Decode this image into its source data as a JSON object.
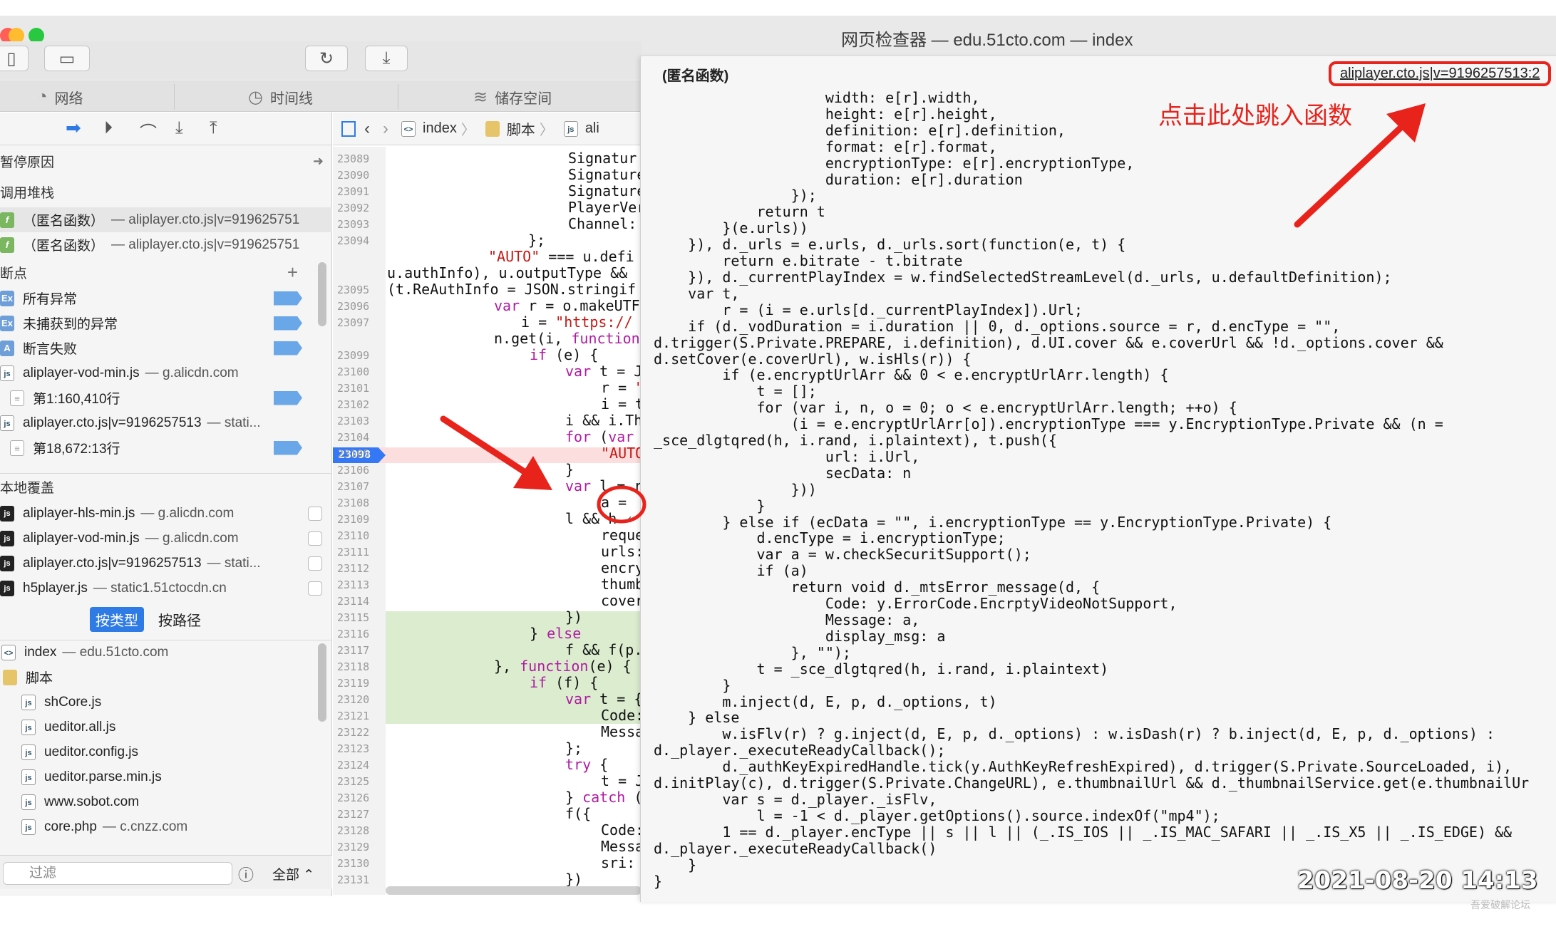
{
  "window": {
    "title": "网页检查器 — edu.51cto.com — index"
  },
  "tabs": [
    {
      "label": "网络",
      "icon": "network-icon"
    },
    {
      "label": "时间线",
      "icon": "clock-icon"
    },
    {
      "label": "储存空间",
      "icon": "storage-icon"
    }
  ],
  "sidebar": {
    "pause_reason": "暂停原因",
    "call_stack": "调用堆栈",
    "stack": [
      {
        "name": "（匿名函数）",
        "location": "— aliplayer.cto.js|v=919625751"
      },
      {
        "name": "（匿名函数）",
        "location": "— aliplayer.cto.js|v=919625751"
      }
    ],
    "breakpoints": "断点",
    "breakpoint_items": [
      {
        "label": "所有异常",
        "icon": "Ex"
      },
      {
        "label": "未捕获到的异常",
        "icon": "Ex"
      },
      {
        "label": "断言失败",
        "icon": "A"
      },
      {
        "label": "aliplayer-vod-min.js",
        "host": "— g.alicdn.com"
      },
      {
        "label": "第1:160,410行"
      },
      {
        "label": "aliplayer.cto.js|v=9196257513",
        "host": "— stati..."
      },
      {
        "label": "第18,672:13行"
      }
    ],
    "local_overrides": "本地覆盖",
    "overrides": [
      {
        "label": "aliplayer-hls-min.js",
        "host": "— g.alicdn.com"
      },
      {
        "label": "aliplayer-vod-min.js",
        "host": "— g.alicdn.com"
      },
      {
        "label": "aliplayer.cto.js|v=9196257513",
        "host": "— stati..."
      },
      {
        "label": "h5player.js",
        "host": "— static1.51ctocdn.cn"
      }
    ],
    "group_by_type": "按类型",
    "group_by_path": "按路径",
    "resources": [
      {
        "label": "index",
        "host": "— edu.51cto.com"
      },
      {
        "label": "脚本"
      },
      {
        "label": "shCore.js"
      },
      {
        "label": "ueditor.all.js"
      },
      {
        "label": "ueditor.config.js"
      },
      {
        "label": "ueditor.parse.min.js"
      },
      {
        "label": "www.sobot.com"
      },
      {
        "label": "core.php",
        "host": "— c.cnzz.com"
      }
    ],
    "filter_placeholder": "过滤",
    "filter_scope": "全部"
  },
  "source": {
    "breadcrumbs": [
      "index",
      "脚本",
      "ali"
    ],
    "line_numbers": [
      "23089",
      "23090",
      "23091",
      "23092",
      "23093",
      "23094",
      "",
      "",
      "23095",
      "23096",
      "23097",
      "23098",
      "23099",
      "23100",
      "23101",
      "23102",
      "23103",
      "23104",
      "23105",
      "23106",
      "23107",
      "23108",
      "23109",
      "23110",
      "23111",
      "23112",
      "23113",
      "23114",
      "23115",
      "23116",
      "23117",
      "23118",
      "23119",
      "23120",
      "23121",
      "23122",
      "23123",
      "23124",
      "23125",
      "23126",
      "23127",
      "23128",
      "23129",
      "23130",
      "23131"
    ],
    "paused_line": "23098"
  },
  "popover": {
    "title": "(匿名函数)",
    "link": "aliplayer.cto.js|v=9196257513:2",
    "code": "                    width: e[r].width,\n                    height: e[r].height,\n                    definition: e[r].definition,\n                    format: e[r].format,\n                    encryptionType: e[r].encryptionType,\n                    duration: e[r].duration\n                });\n            return t\n        }(e.urls))\n    }), d._urls = e.urls, d._urls.sort(function(e, t) {\n        return e.bitrate - t.bitrate\n    }), d._currentPlayIndex = w.findSelectedStreamLevel(d._urls, u.defaultDefinition);\n    var t,\n        r = (i = e.urls[d._currentPlayIndex]).Url;\n    if (d._vodDuration = i.duration || 0, d._options.source = r, d.encType = \"\",\nd.trigger(S.Private.PREPARE, i.definition), d.UI.cover && e.coverUrl && !d._options.cover &&\nd.setCover(e.coverUrl), w.isHls(r)) {\n        if (e.encryptUrlArr && 0 < e.encryptUrlArr.length) {\n            t = [];\n            for (var i, n, o = 0; o < e.encryptUrlArr.length; ++o) {\n                (i = e.encryptUrlArr[o]).encryptionType === y.EncryptionType.Private && (n =\n_sce_dlgtqred(h, i.rand, i.plaintext), t.push({\n                    url: i.Url,\n                    secData: n\n                }))\n            }\n        } else if (ecData = \"\", i.encryptionType == y.EncryptionType.Private) {\n            d.encType = i.encryptionType;\n            var a = w.checkSecuritSupport();\n            if (a)\n                return void d._mtsError_message(d, {\n                    Code: y.ErrorCode.EncrptyVideoNotSupport,\n                    Message: a,\n                    display_msg: a\n                }, \"\");\n            t = _sce_dlgtqred(h, i.rand, i.plaintext)\n        }\n        m.inject(d, E, p, d._options, t)\n    } else\n        w.isFlv(r) ? g.inject(d, E, p, d._options) : w.isDash(r) ? b.inject(d, E, p, d._options) :\nd._player._executeReadyCallback();\n        d._authKeyExpiredHandle.tick(y.AuthKeyRefreshExpired), d.trigger(S.Private.SourceLoaded, i),\nd.initPlay(c), d.trigger(S.Private.ChangeURL), e.thumbnailUrl && d._thumbnailService.get(e.thumbnailUr\n        var s = d._player._isFlv,\n            l = -1 < d._player.getOptions().source.indexOf(\"mp4\");\n        1 == d._player.encType || s || l || (_.IS_IOS || _.IS_MAC_SAFARI || _.IS_X5 || _.IS_EDGE) &&\nd._player._executeReadyCallback()\n    }\n}"
  },
  "annotation": {
    "text": "点击此处跳入函数",
    "color": "#e8231c"
  },
  "timestamp": "2021-08-20 14:13",
  "watermark": "吾爱破解论坛"
}
